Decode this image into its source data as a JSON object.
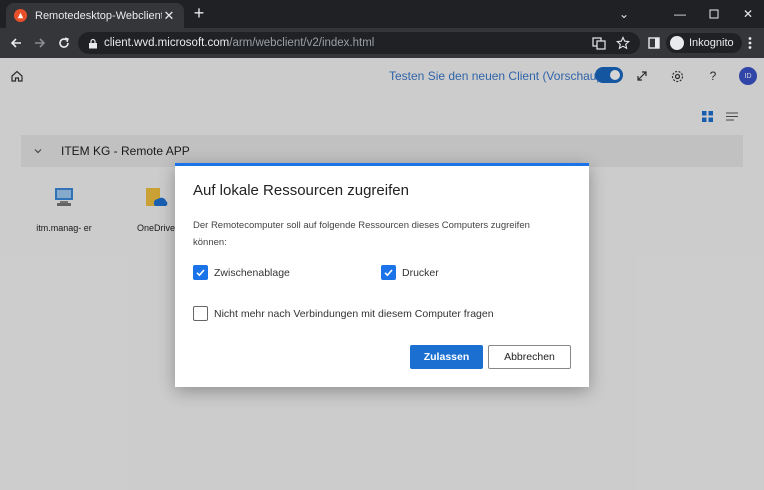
{
  "browser": {
    "tab_title": "Remotedesktop-Webclient",
    "url_domain": "client.wvd.microsoft.com",
    "url_path": "/arm/webclient/v2/index.html",
    "profile_label": "Inkognito"
  },
  "header": {
    "preview_label": "Testen Sie den neuen Client (Vorschau)",
    "preview_toggle_on": true,
    "user_initials": "ID"
  },
  "workspace": {
    "group_title": "ITEM KG - Remote APP",
    "apps": [
      {
        "label": "itm.manag- er"
      },
      {
        "label": "OneDrive"
      }
    ]
  },
  "dialog": {
    "title": "Auf lokale Ressourcen zugreifen",
    "description": "Der Remotecomputer soll auf folgende Ressourcen dieses Computers zugreifen können:",
    "options": [
      {
        "label": "Zwischenablage",
        "checked": true
      },
      {
        "label": "Drucker",
        "checked": true
      }
    ],
    "dont_ask_label": "Nicht mehr nach Verbindungen mit diesem Computer fragen",
    "dont_ask_checked": false,
    "allow_label": "Zulassen",
    "cancel_label": "Abbrechen"
  },
  "colors": {
    "accent": "#1a73e8",
    "chrome_dark": "#202124",
    "preview_text": "#3a78c9"
  }
}
